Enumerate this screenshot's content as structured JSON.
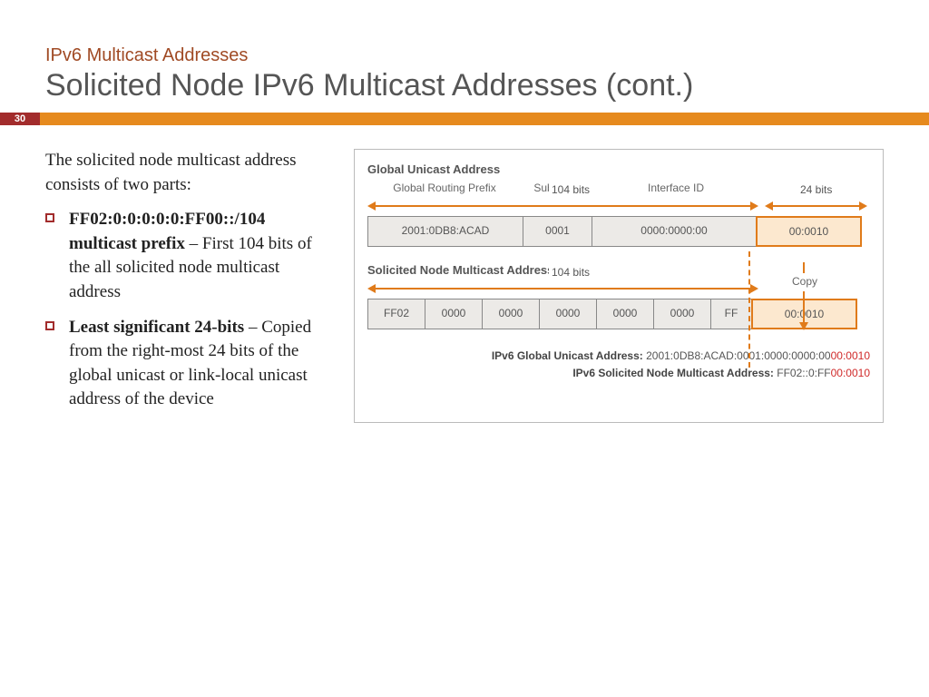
{
  "slide_number": "30",
  "pretitle": "IPv6 Multicast Addresses",
  "title": "Solicited Node IPv6 Multicast Addresses (cont.)",
  "left": {
    "intro": "The solicited node multicast address consists of two parts:",
    "bullets": [
      {
        "bold": "FF02:0:0:0:0:0:FF00::/104 multicast prefix",
        "rest": " – First 104 bits of the all solicited node multicast address"
      },
      {
        "bold": "Least significant 24-bits",
        "rest": " – Copied from the right-most 24 bits of the global unicast or link-local unicast address of the device"
      }
    ]
  },
  "diagram": {
    "section1_title": "Global Unicast Address",
    "col_prefix": "Global Routing Prefix",
    "col_subnet": "Subnet ID",
    "col_iface": "Interface ID",
    "bits104": "104 bits",
    "bits24": "24 bits",
    "row1": {
      "prefix": "2001:0DB8:ACAD",
      "subnet": "0001",
      "iface": "0000:0000:00",
      "last": "00:0010"
    },
    "copy_label": "Copy",
    "section2_title": "Solicited Node Multicast Address",
    "row2": {
      "c1": "FF02",
      "c2": "0000",
      "c3": "0000",
      "c4": "0000",
      "c5": "0000",
      "c6": "0000",
      "c7": "FF",
      "last": "00:0010"
    },
    "footer": {
      "l1_label": "IPv6 Global Unicast Address: ",
      "l1_black": "2001:0DB8:ACAD:0001:0000:0000:00",
      "l1_red": "00:0010",
      "l2_label": "IPv6 Solicited Node Multicast Address: ",
      "l2_black": "FF02::0:FF",
      "l2_red": "00:0010"
    }
  }
}
